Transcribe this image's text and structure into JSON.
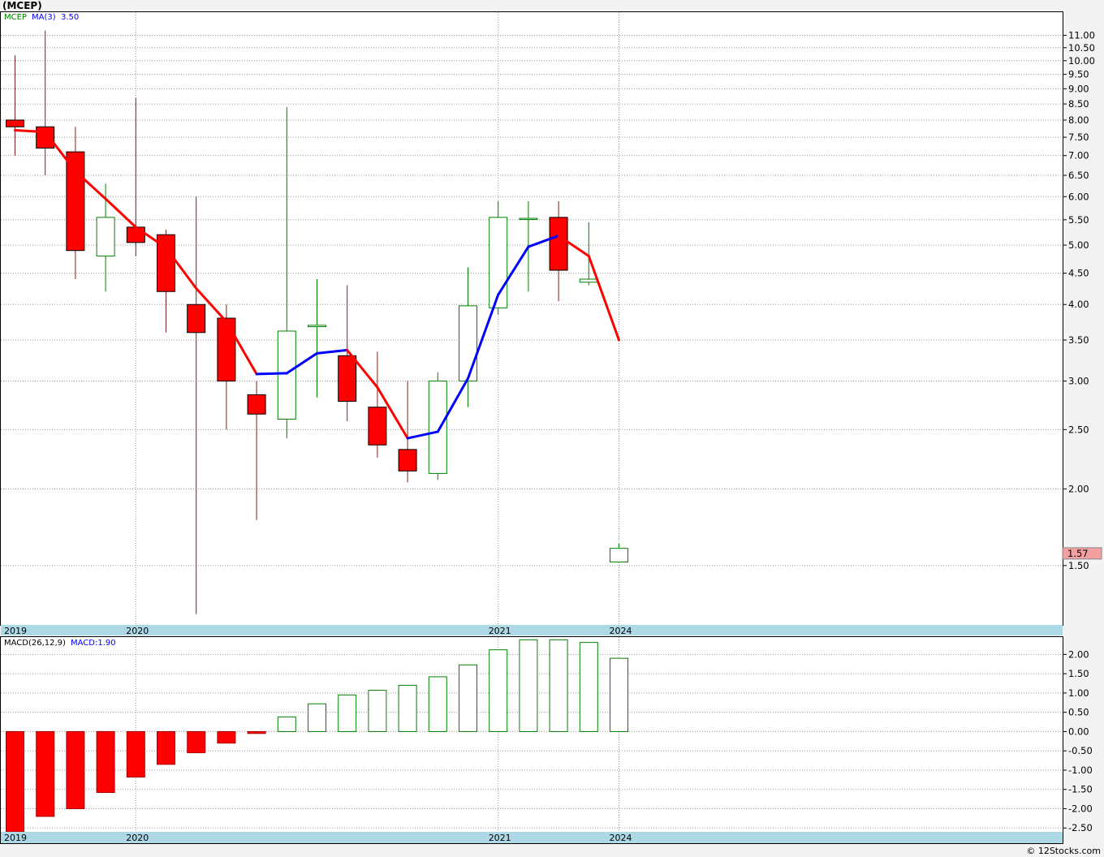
{
  "title": "(MCEP)",
  "footer": "© 12Stocks.com",
  "chart_data": [
    {
      "type": "candlestick",
      "ticker": "MCEP",
      "legend": {
        "symbol": "MCEP",
        "ma_label": "MA(3)",
        "ma_value": "3.50"
      },
      "y_scale": "log",
      "ylim": [
        1.2,
        12.0
      ],
      "y_ticks": [
        11.0,
        10.5,
        10.0,
        9.5,
        9.0,
        8.5,
        8.0,
        7.5,
        7.0,
        6.5,
        6.0,
        5.5,
        5.0,
        4.5,
        4.0,
        3.5,
        3.0,
        2.5,
        2.0,
        1.5
      ],
      "y_tick_labels": [
        "11.00",
        "10.50",
        "10.00",
        "9.50",
        "9.00",
        "8.50",
        "8.00",
        "7.50",
        "7.00",
        "6.50",
        "6.00",
        "5.50",
        "5.00",
        "4.50",
        "4.00",
        "3.50",
        "3.00",
        "2.50",
        "2.00",
        "1.50"
      ],
      "last_price_label": "1.57",
      "last_price": 1.57,
      "year_labels": [
        {
          "label": "2019",
          "index": -0.3
        },
        {
          "label": "2020",
          "index": 4
        },
        {
          "label": "2021",
          "index": 16
        },
        {
          "label": "2024",
          "index": 20
        }
      ],
      "candles": [
        {
          "o": 8.0,
          "h": 10.2,
          "l": 7.0,
          "c": 7.8
        },
        {
          "o": 7.8,
          "h": 11.2,
          "l": 6.5,
          "c": 7.2
        },
        {
          "o": 7.1,
          "h": 7.8,
          "l": 4.4,
          "c": 4.9
        },
        {
          "o": 4.8,
          "h": 6.3,
          "l": 4.2,
          "c": 5.55
        },
        {
          "o": 5.35,
          "h": 8.7,
          "l": 4.8,
          "c": 5.05
        },
        {
          "o": 5.2,
          "h": 5.3,
          "l": 3.6,
          "c": 4.2
        },
        {
          "o": 4.0,
          "h": 6.0,
          "l": 1.25,
          "c": 3.6
        },
        {
          "o": 3.8,
          "h": 4.0,
          "l": 2.5,
          "c": 3.0
        },
        {
          "o": 2.85,
          "h": 3.0,
          "l": 1.78,
          "c": 2.65
        },
        {
          "o": 2.6,
          "h": 8.4,
          "l": 2.42,
          "c": 3.62
        },
        {
          "o": 3.68,
          "h": 4.4,
          "l": 2.82,
          "c": 3.7
        },
        {
          "o": 3.3,
          "h": 4.3,
          "l": 2.58,
          "c": 2.78
        },
        {
          "o": 2.72,
          "h": 3.35,
          "l": 2.25,
          "c": 2.36
        },
        {
          "o": 2.32,
          "h": 3.0,
          "l": 2.05,
          "c": 2.14
        },
        {
          "o": 2.12,
          "h": 3.1,
          "l": 2.07,
          "c": 3.0
        },
        {
          "o": 3.0,
          "h": 4.6,
          "l": 2.72,
          "c": 3.98
        },
        {
          "o": 3.95,
          "h": 5.9,
          "l": 3.85,
          "c": 5.55
        },
        {
          "o": 5.52,
          "h": 5.9,
          "l": 4.2,
          "c": 5.53
        },
        {
          "o": 5.55,
          "h": 5.9,
          "l": 4.05,
          "c": 4.55
        },
        {
          "o": 4.35,
          "h": 5.45,
          "l": 4.3,
          "c": 4.4
        },
        {
          "o": 1.52,
          "h": 1.63,
          "l": 1.52,
          "c": 1.6
        }
      ],
      "ma": [
        7.7,
        7.65,
        6.6,
        5.95,
        5.35,
        4.95,
        4.25,
        3.75,
        3.08,
        3.09,
        3.33,
        3.37,
        2.93,
        2.42,
        2.48,
        3.03,
        4.15,
        4.97,
        5.18,
        4.8,
        3.5
      ],
      "ma_colors": [
        "#ff0000",
        "#ff0000",
        "#ff0000",
        "#ff0000",
        "#ff0000",
        "#ff0000",
        "#ff0000",
        "#ff0000",
        "#0000ff",
        "#0000ff",
        "#0000ff",
        "#ff0000",
        "#ff0000",
        "#0000ff",
        "#0000ff",
        "#0000ff",
        "#0000ff",
        "#0000ff",
        "#ff0000",
        "#ff0000"
      ]
    },
    {
      "type": "bar",
      "indicator": "MACD",
      "legend": {
        "params": "MACD(26,12,9)",
        "value_label": "MACD:1.90"
      },
      "ylim": [
        -2.6,
        2.45
      ],
      "y_ticks": [
        2.0,
        1.5,
        1.0,
        0.5,
        0.0,
        -0.5,
        -1.0,
        -1.5,
        -2.0,
        -2.5
      ],
      "y_tick_labels": [
        "2.00",
        "1.50",
        "1.00",
        "0.50",
        "0.00",
        "-0.50",
        "-1.00",
        "-1.50",
        "-2.00",
        "-2.50"
      ],
      "year_labels": [
        {
          "label": "2019",
          "index": -0.3
        },
        {
          "label": "2020",
          "index": 4
        },
        {
          "label": "2021",
          "index": 16
        },
        {
          "label": "2024",
          "index": 20
        }
      ],
      "values": [
        -2.7,
        -2.2,
        -2.0,
        -1.58,
        -1.18,
        -0.85,
        -0.55,
        -0.3,
        -0.05,
        0.38,
        0.72,
        0.95,
        1.07,
        1.2,
        1.42,
        1.73,
        2.12,
        2.38,
        2.38,
        2.31,
        1.9
      ]
    }
  ],
  "colors": {
    "up": "#008000",
    "down": "#ff0000",
    "ma_up": "#0000ff",
    "ma_down": "#ff0000",
    "time_axis_band": "#add8e6",
    "grid": "#999999",
    "price_tag_bg": "#f4a0a0"
  }
}
